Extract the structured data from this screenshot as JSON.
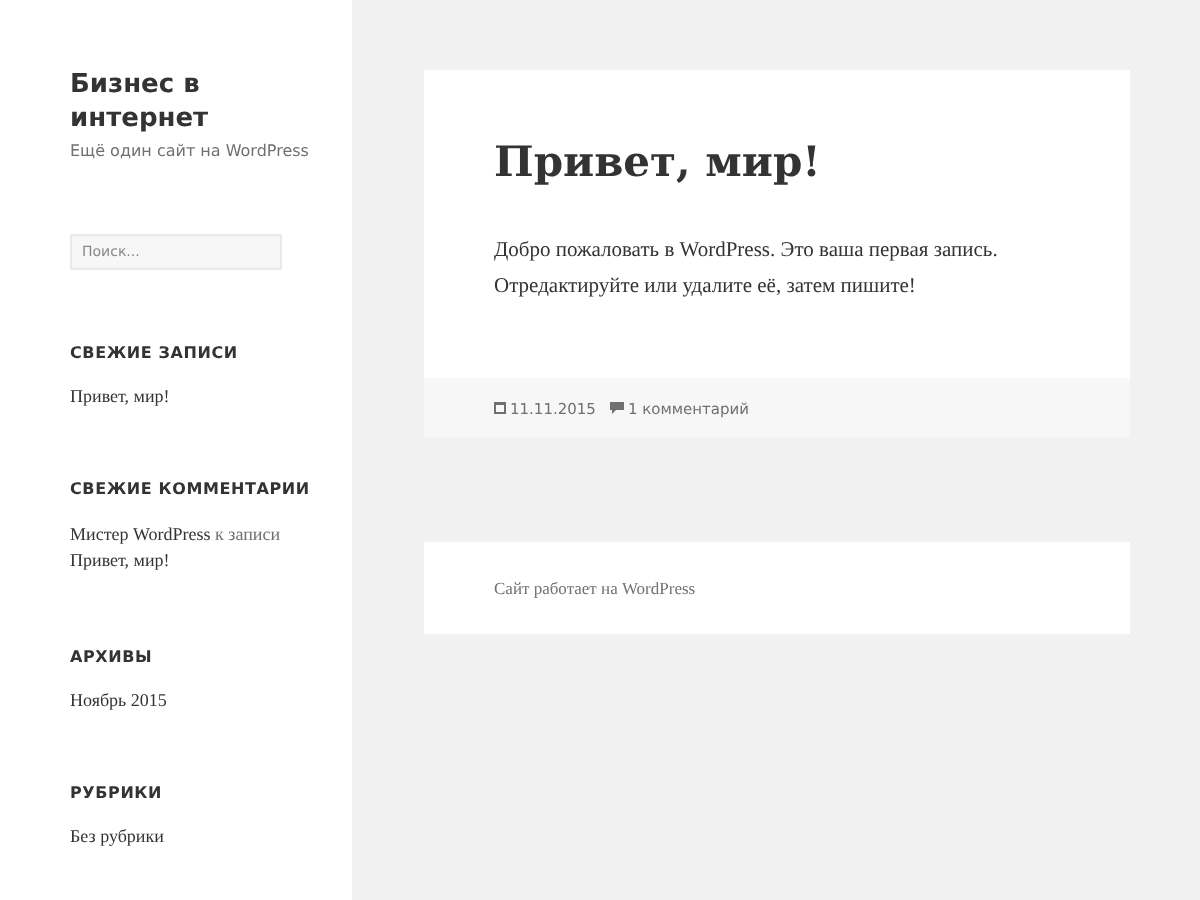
{
  "site": {
    "title": "Бизнес в интернет",
    "tagline": "Ещё один сайт на WordPress"
  },
  "search": {
    "placeholder": "Поиск..."
  },
  "widgets": [
    {
      "heading": "СВЕЖИЕ ЗАПИСИ",
      "kind": "links",
      "items": [
        "Привет, мир!"
      ]
    },
    {
      "heading": "СВЕЖИЕ КОММЕНТАРИИ",
      "kind": "comment",
      "author": "Мистер WordPress",
      "joiner": "к записи",
      "post": "Привет, мир!"
    },
    {
      "heading": "АРХИВЫ",
      "kind": "links",
      "items": [
        "Ноябрь 2015"
      ]
    },
    {
      "heading": "РУБРИКИ",
      "kind": "links",
      "items": [
        "Без рубрики"
      ]
    }
  ],
  "post": {
    "title": "Привет, мир!",
    "body": "Добро пожаловать в WordPress. Это ваша первая запись. Отредактируйте или удалите её, затем пишите!",
    "date": "11.11.2015",
    "comments": "1 комментарий"
  },
  "footer": {
    "text": "Сайт работает на WordPress"
  }
}
